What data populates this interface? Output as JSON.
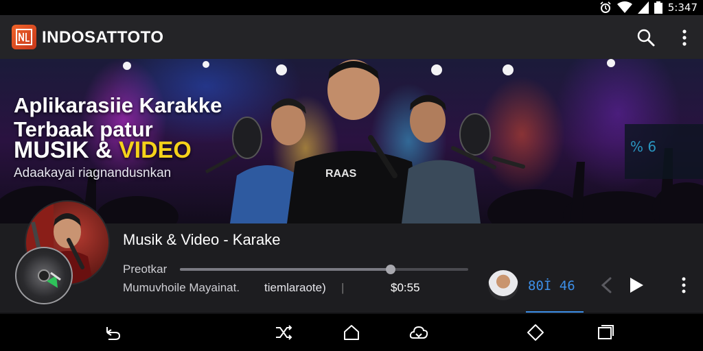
{
  "status_bar": {
    "time": "5:347",
    "icons": [
      "alarm-icon",
      "wifi-icon",
      "signal-icon",
      "battery-icon"
    ]
  },
  "app_bar": {
    "logo_icon": "brand-logo-icon",
    "title": "INDOSATTOTO",
    "actions": [
      "search-icon",
      "more-vert-icon"
    ]
  },
  "banner": {
    "line1": "Aplikarasiie Karakke",
    "line2": "Terbaak patur",
    "line3_word1": "MUSIK & ",
    "line3_word2": "VIDEO",
    "line4": "Adaakayai riagnandusnkan",
    "shirt_text": "RAAS"
  },
  "player": {
    "title": "Musik & Video - Karake",
    "label": "Preotkar",
    "subtitle": "Mumuvhoile Mayainat.",
    "subtitle_right": "tiemlaraote)",
    "separator": "|",
    "time": "$0:55",
    "counter": "80İ 46",
    "progress": 0.73,
    "controls": [
      "previous-icon",
      "play-icon",
      "more-vert-icon"
    ]
  },
  "nav_bar": {
    "buttons": [
      "back-icon",
      "shuffle-icon",
      "home-icon",
      "cloud-icon",
      "diamond-icon",
      "recents-icon"
    ]
  },
  "colors": {
    "app_bar_bg": "#242427",
    "player_bg": "#1d1d20",
    "accent_blue": "#3d8fe8",
    "brand_orange": "#f0642a",
    "banner_yellow": "#f5d21a"
  }
}
